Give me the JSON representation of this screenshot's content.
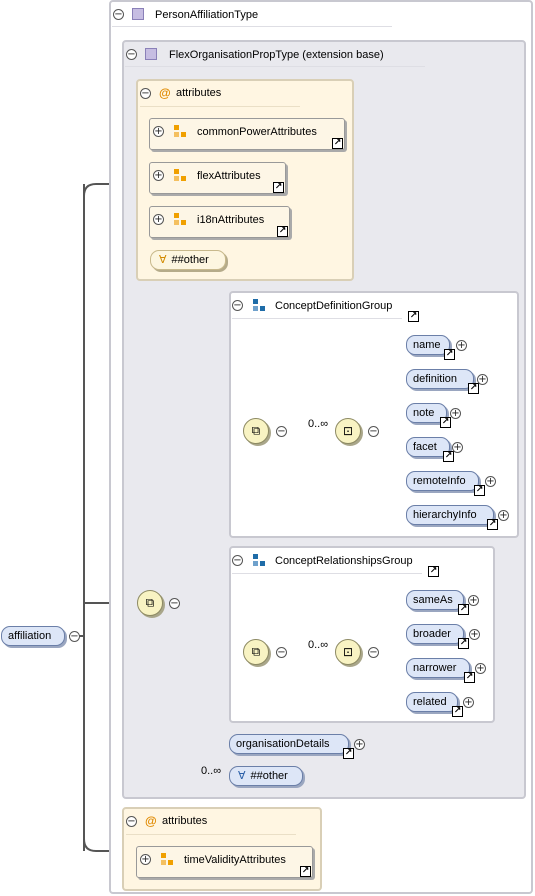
{
  "root": {
    "label": "affiliation"
  },
  "type": {
    "title": "PersonAffiliationType",
    "extension": {
      "title": "FlexOrganisationPropType (extension base)",
      "attributes": {
        "title": "attributes",
        "groups": [
          "commonPowerAttributes",
          "flexAttributes",
          "i18nAttributes"
        ],
        "any": "##other"
      },
      "concept_definition_group": {
        "title": "ConceptDefinitionGroup",
        "multiplicity": "0..∞",
        "elements": [
          "name",
          "definition",
          "note",
          "facet",
          "remoteInfo",
          "hierarchyInfo"
        ]
      },
      "concept_relationships_group": {
        "title": "ConceptRelationshipsGroup",
        "multiplicity": "0..∞",
        "elements": [
          "sameAs",
          "broader",
          "narrower",
          "related"
        ]
      },
      "organisation_details": "organisationDetails",
      "any_other": {
        "label": "##other",
        "multiplicity": "0..∞"
      }
    },
    "attributes": {
      "title": "attributes",
      "groups": [
        "timeValidityAttributes"
      ]
    }
  },
  "symbols": {
    "collapse": "−",
    "expand": "+",
    "at": "@",
    "any": "∀",
    "link": "↗"
  },
  "colors": {
    "element_fill": "#dde6f7",
    "attribute_fill": "#fff6e2",
    "compositor_fill": "#f8f3c3",
    "group_frame": "#e9e9ee"
  }
}
